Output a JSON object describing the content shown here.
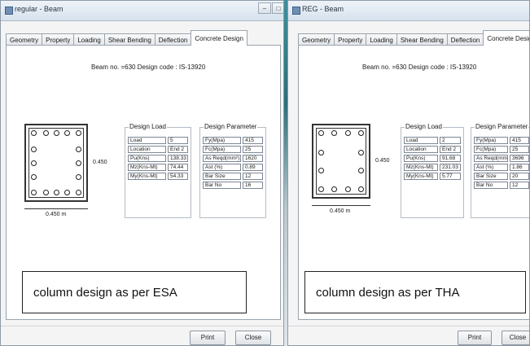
{
  "left": {
    "title": "regular - Beam",
    "tabs": [
      "Geometry",
      "Property",
      "Loading",
      "Shear Bending",
      "Deflection",
      "Concrete Design"
    ],
    "beam_title": "Beam no. =630  Design code : IS-13920",
    "section": {
      "depth": "0.450",
      "width": "0.450 m"
    },
    "design_load": {
      "title": "Design Load",
      "rows": [
        {
          "label": "Load",
          "value": "5"
        },
        {
          "label": "Location",
          "value": "End 2"
        },
        {
          "label": "Pu(Kns)",
          "value": "138.33"
        },
        {
          "label": "Mz(Kns-Mt)",
          "value": "74.44"
        },
        {
          "label": "My(Kns-Mt)",
          "value": "54.33"
        }
      ]
    },
    "design_parameter": {
      "title": "Design Parameter",
      "rows": [
        {
          "label": "Fy(Mpa)",
          "value": "415"
        },
        {
          "label": "Fc(Mpa)",
          "value": "25"
        },
        {
          "label": "As Reqd(mm²)",
          "value": "1620"
        },
        {
          "label": "Ast (%)",
          "value": "0.89"
        },
        {
          "label": "Bar Size",
          "value": "12"
        },
        {
          "label": "Bar No",
          "value": "16"
        }
      ]
    },
    "caption": "column design as per ESA",
    "print_label": "Print",
    "close_label": "Close"
  },
  "right": {
    "title": "REG - Beam",
    "tabs": [
      "Geometry",
      "Property",
      "Loading",
      "Shear Bending",
      "Deflection",
      "Concrete Design"
    ],
    "beam_title": "Beam no. =630  Design code : IS-13920",
    "section": {
      "depth": "0.450",
      "width": "0.450 m"
    },
    "design_load": {
      "title": "Design Load",
      "rows": [
        {
          "label": "Load",
          "value": "2"
        },
        {
          "label": "Location",
          "value": "End 2"
        },
        {
          "label": "Pu(Kns)",
          "value": "91.68"
        },
        {
          "label": "Mz(Kns-Mt)",
          "value": "231.03"
        },
        {
          "label": "My(Kns-Mt)",
          "value": "5.77"
        }
      ]
    },
    "design_parameter": {
      "title": "Design Parameter",
      "rows": [
        {
          "label": "Fy(Mpa)",
          "value": "415"
        },
        {
          "label": "Fc(Mpa)",
          "value": "25"
        },
        {
          "label": "As Reqd(mm²)",
          "value": "3696"
        },
        {
          "label": "Ast (%)",
          "value": "1.86"
        },
        {
          "label": "Bar Size",
          "value": "20"
        },
        {
          "label": "Bar No",
          "value": "12"
        }
      ]
    },
    "caption": "column design as per THA",
    "print_label": "Print",
    "close_label": "Close"
  }
}
